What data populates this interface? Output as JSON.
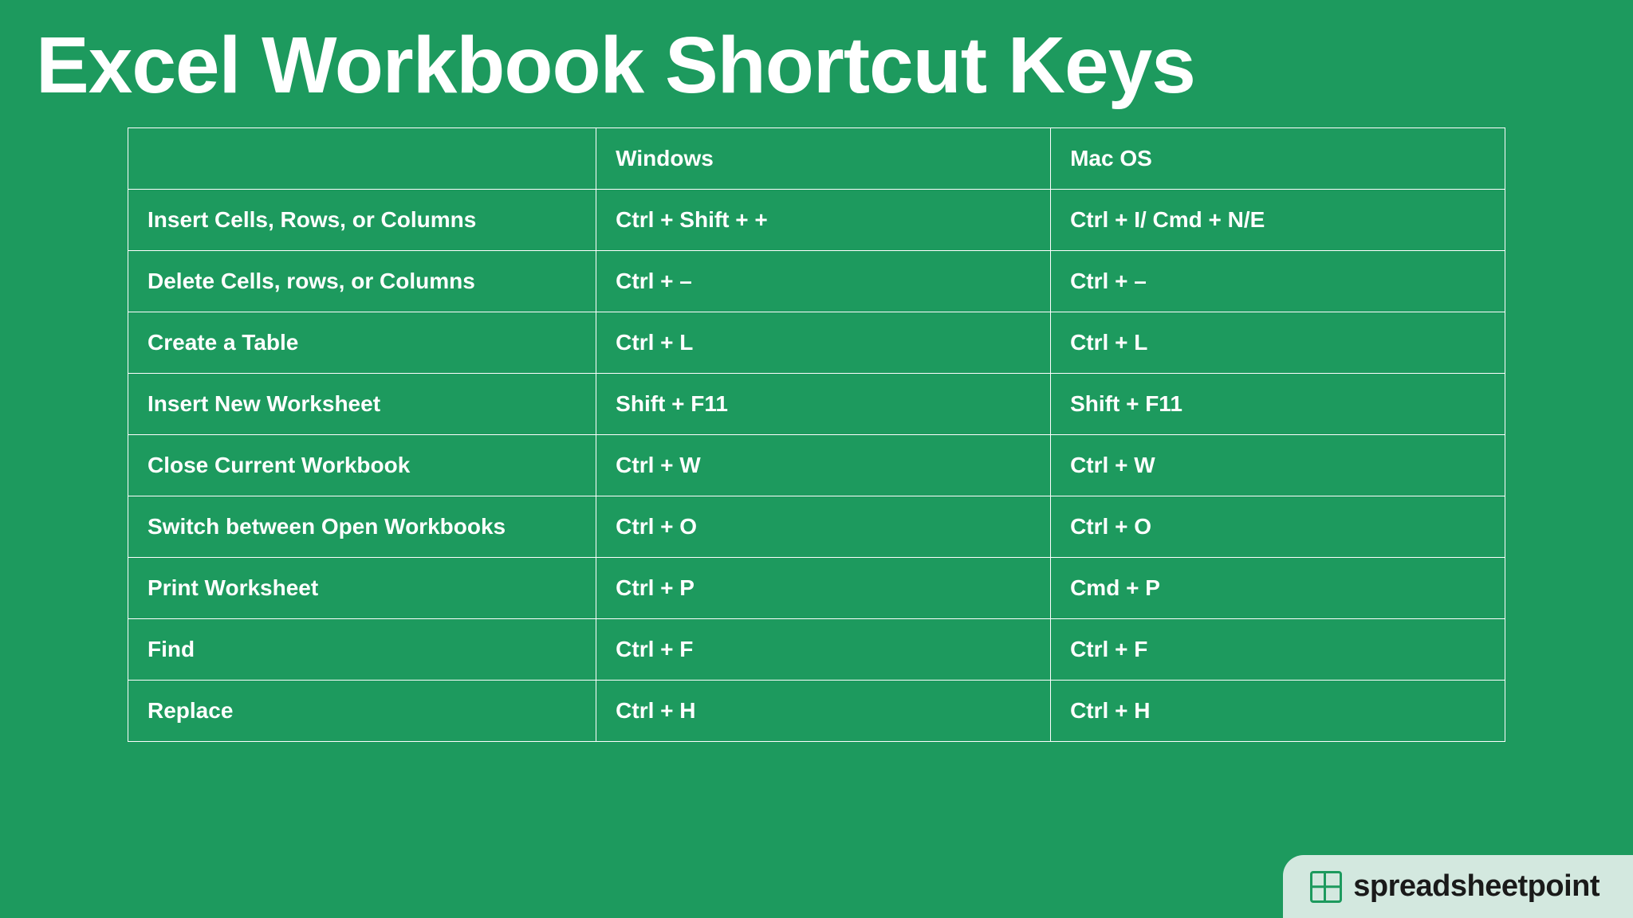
{
  "title": "Excel Workbook Shortcut Keys",
  "columns": {
    "action": "",
    "windows": "Windows",
    "mac": "Mac OS"
  },
  "rows": [
    {
      "action": "Insert Cells, Rows, or Columns",
      "windows": "Ctrl + Shift + +",
      "mac": "Ctrl + I/ Cmd + N/E"
    },
    {
      "action": "Delete Cells, rows, or Columns",
      "windows": "Ctrl + –",
      "mac": "Ctrl + –"
    },
    {
      "action": "Create a Table",
      "windows": "Ctrl + L",
      "mac": "Ctrl + L"
    },
    {
      "action": "Insert New Worksheet",
      "windows": "Shift + F11",
      "mac": "Shift + F11"
    },
    {
      "action": "Close Current Workbook",
      "windows": "Ctrl + W",
      "mac": "Ctrl + W"
    },
    {
      "action": "Switch between Open Workbooks",
      "windows": "Ctrl + O",
      "mac": "Ctrl + O"
    },
    {
      "action": "Print Worksheet",
      "windows": "Ctrl + P",
      "mac": "Cmd + P"
    },
    {
      "action": "Find",
      "windows": "Ctrl + F",
      "mac": "Ctrl + F"
    },
    {
      "action": "Replace",
      "windows": "Ctrl + H",
      "mac": "Ctrl + H"
    }
  ],
  "logo": {
    "text": "spreadsheetpoint"
  }
}
